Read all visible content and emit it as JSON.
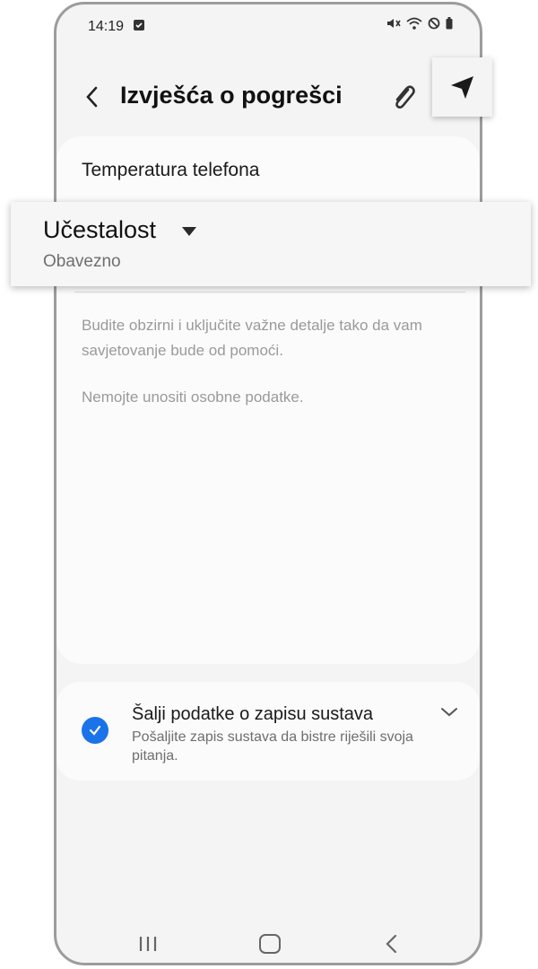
{
  "status": {
    "time": "14:19"
  },
  "header": {
    "title": "Izvješća o pogrešci"
  },
  "form": {
    "temperature_label": "Temperatura telefona",
    "help_text": "Budite obzirni i uključite važne detalje tako da vam savjetovanje bude od pomoći.",
    "privacy_text": "Nemojte unositi osobne podatke."
  },
  "popup": {
    "title": "Učestalost",
    "subtitle": "Obavezno"
  },
  "log": {
    "title": "Šalji podatke o zapisu sustava",
    "description": "Pošaljite zapis sustava da bistre riješili svoja pitanja.",
    "checked": true
  },
  "colors": {
    "accent": "#1a73e8"
  }
}
